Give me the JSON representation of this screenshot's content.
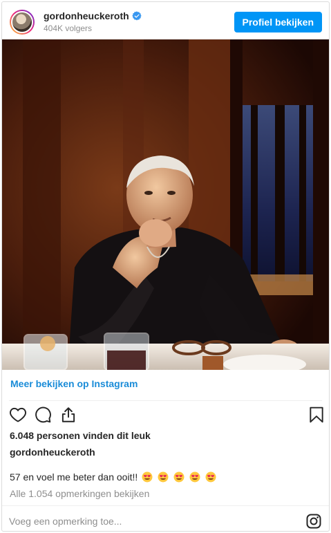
{
  "header": {
    "username": "gordonheuckeroth",
    "followers": "404K volgers",
    "profile_button": "Profiel bekijken"
  },
  "post": {
    "image_alt": "gordonheuckeroth post photo",
    "more_link": "Meer bekijken op Instagram",
    "likes": "6.048 personen vinden dit leuk",
    "caption_user": "gordonheuckeroth",
    "caption_text": "57 en voel me beter dan ooit!!",
    "emojis": [
      "smiling-face-with-heart-eyes",
      "smiling-face-with-heart-eyes",
      "smiling-face-with-heart-eyes",
      "smiling-face-with-heart-eyes",
      "smiling-face-with-heart-eyes"
    ],
    "comments_link": "Alle 1.054 opmerkingen bekijken"
  },
  "footer": {
    "comment_placeholder": "Voeg een opmerking toe..."
  },
  "colors": {
    "accent": "#0095f6",
    "link": "#1a8cd8",
    "muted": "#8e8e8e"
  },
  "icons": [
    "verified-icon",
    "heart-icon",
    "comment-icon",
    "share-icon",
    "bookmark-icon",
    "instagram-icon"
  ]
}
